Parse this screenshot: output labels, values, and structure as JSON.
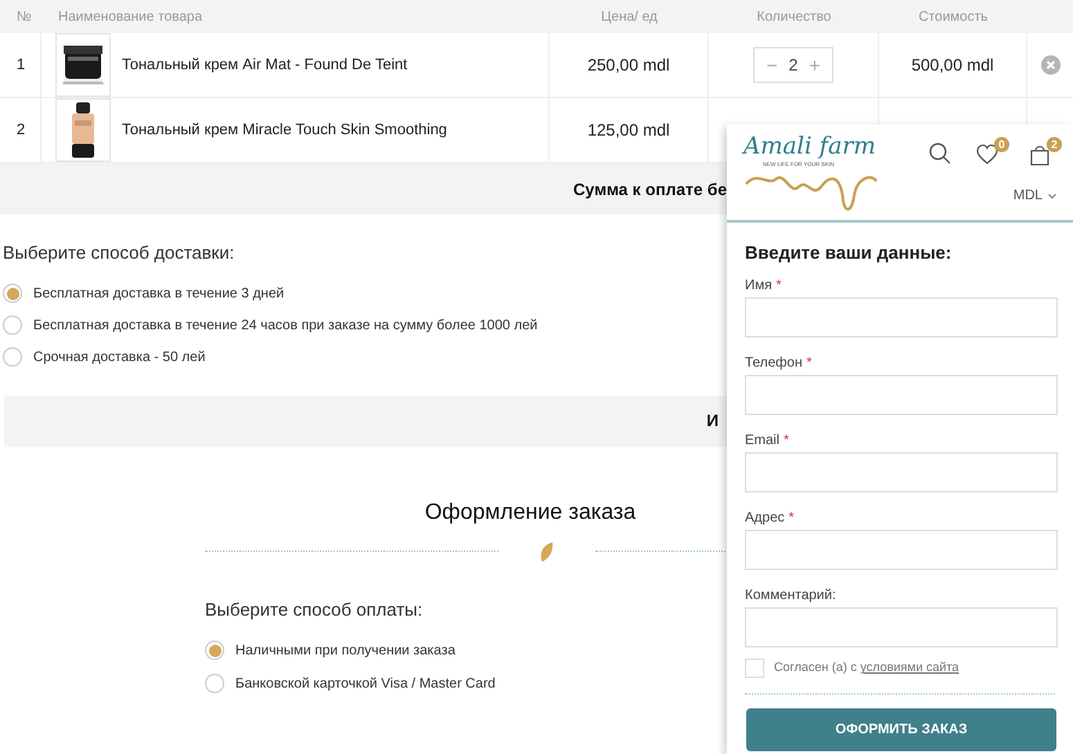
{
  "cart_table": {
    "columns": [
      "№",
      "Наименование товара",
      "Цена/ ед",
      "Количество",
      "Стоимость"
    ],
    "rows": [
      {
        "number": "1",
        "name": "Тональный крем Air Mat - Found De Teint",
        "price": "250,00 mdl",
        "quantity": "2",
        "quantity_minus": "−",
        "quantity_plus": "+",
        "cost": "500,00 mdl",
        "kind": "jar"
      },
      {
        "number": "2",
        "name": "Тональный крем Miracle Touch Skin Smoothing",
        "price": "125,00 mdl",
        "kind": "bottle"
      }
    ],
    "total_label": "Сумма к оплате бе"
  },
  "delivery": {
    "heading": "Выберите способ доставки:",
    "options": [
      {
        "label": "Бесплатная доставка в течение 3 дней",
        "selected": true
      },
      {
        "label": "Бесплатная доставка в течение 24 часов при заказе на сумму более 1000 лей",
        "selected": false
      },
      {
        "label": "Срочная доставка - 50 лей",
        "selected": false
      }
    ],
    "bar_text": "И"
  },
  "checkout": {
    "title": "Оформление заказа",
    "payment_heading": "Выберите способ оплаты:",
    "payment_options": [
      {
        "label": "Наличными при получении заказа",
        "selected": true
      },
      {
        "label": "Банковской карточкой Visa / Master Card",
        "selected": false
      }
    ]
  },
  "panel": {
    "logo": {
      "name": "Amali farm",
      "tagline": "NEW LIFE FOR YOUR SKIN"
    },
    "wishlist_count": "0",
    "cart_count": "2",
    "currency": "MDL",
    "form_heading": "Введите ваши данные:",
    "fields": [
      {
        "label": "Имя",
        "required_mark": "*"
      },
      {
        "label": "Телефон",
        "required_mark": "*"
      },
      {
        "label": "Email",
        "required_mark": "*"
      },
      {
        "label": "Адрес",
        "required_mark": "*"
      },
      {
        "label": "Комментарий:"
      }
    ],
    "agree": {
      "text": "Согласен (а) с ",
      "link": "условиями сайта",
      "checked": false
    },
    "submit": "ОФОРМИТЬ ЗАКАЗ"
  }
}
